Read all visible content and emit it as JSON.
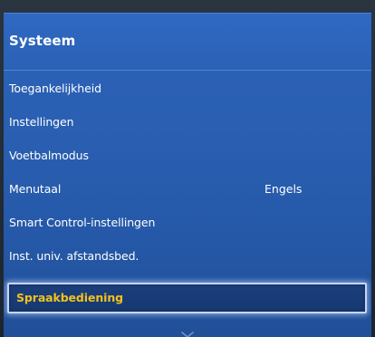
{
  "panel": {
    "title": "Systeem"
  },
  "menu": {
    "items": [
      {
        "label": "Toegankelijkheid",
        "value": ""
      },
      {
        "label": "Instellingen",
        "value": ""
      },
      {
        "label": "Voetbalmodus",
        "value": ""
      },
      {
        "label": "Menutaal",
        "value": "Engels"
      },
      {
        "label": "Smart Control-instellingen",
        "value": ""
      },
      {
        "label": "Inst. univ. afstandsbed.",
        "value": ""
      },
      {
        "label": "Spraakbediening",
        "value": "",
        "selected": true
      }
    ]
  },
  "colors": {
    "panel_blue": "#2a5fb2",
    "selected_text": "#f2c21c",
    "text": "#ffffff",
    "selection_outline": "#c7d6f0"
  },
  "icons": {
    "scroll": "chevron-down-icon"
  }
}
